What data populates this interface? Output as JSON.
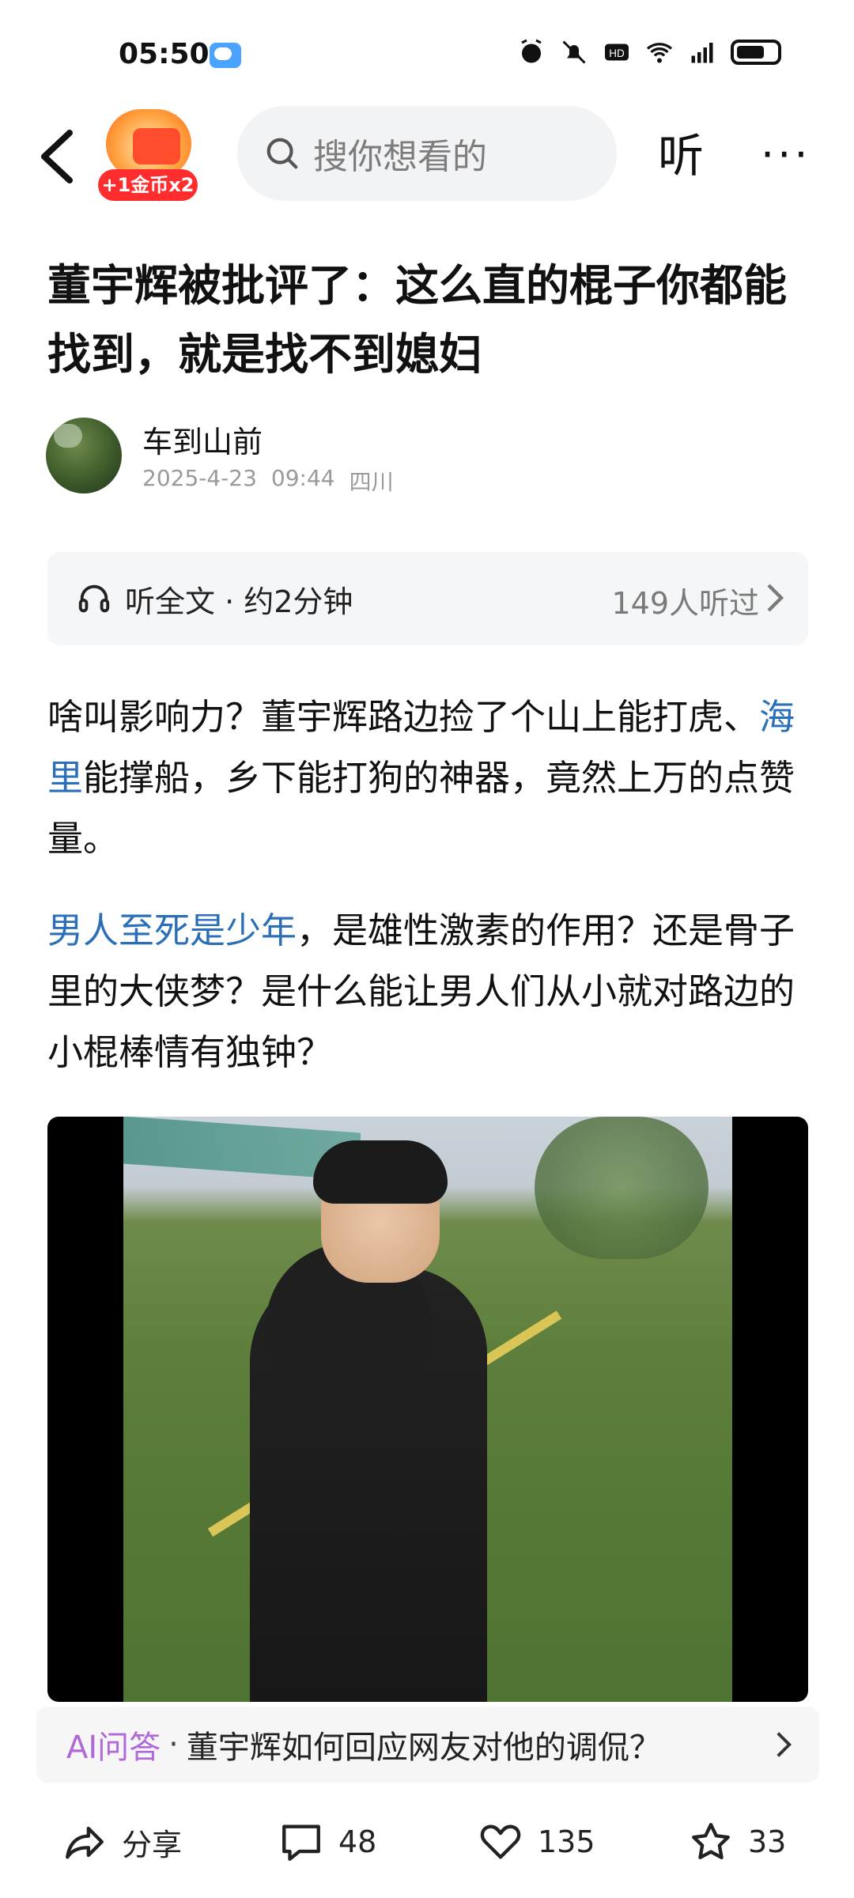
{
  "status_bar": {
    "time": "05:50"
  },
  "top_nav": {
    "coin_badge": "+1金币x2",
    "search_placeholder": "搜你想看的",
    "listen": "听",
    "more": "···"
  },
  "article": {
    "title": "董宇辉被批评了：这么直的棍子你都能找到，就是找不到媳妇",
    "author": {
      "name": "车到山前",
      "date": "2025-4-23",
      "time": "09:44",
      "location": "四川"
    },
    "listen_bar": {
      "label": "听全文 · 约2分钟",
      "count": "149人听过"
    },
    "paragraph1": {
      "part1": "啥叫影响力？董宇辉路边捡了个山上能打虎、",
      "link": "海里",
      "part2": "能撑船，乡下能打狗的神器，竟然上万的点赞量。"
    },
    "paragraph2": {
      "link": "男人至死是少年",
      "part": "，是雄性激素的作用？还是骨子里的大侠梦？是什么能让男人们从小就对路边的小棍棒情有独钟？"
    }
  },
  "ai_bar": {
    "label": "AI问答",
    "dot": "·",
    "question": "董宇辉如何回应网友对他的调侃？"
  },
  "bottom_bar": {
    "share": "分享",
    "comments": "48",
    "likes": "135",
    "favorites": "33"
  },
  "colors": {
    "link": "#2a6fb7",
    "ai_label": "#b169d8",
    "coin_badge": "#ff2d2d"
  }
}
